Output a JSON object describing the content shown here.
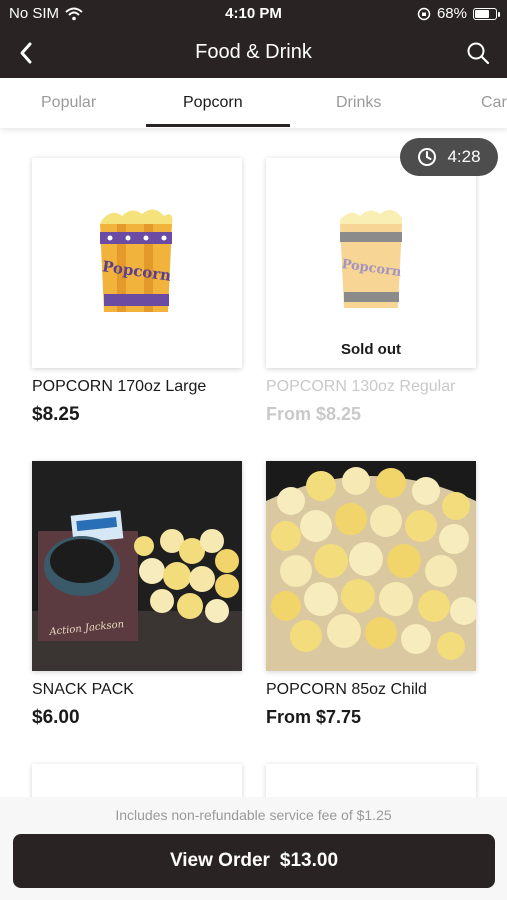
{
  "status": {
    "carrier": "No SIM",
    "time": "4:10 PM",
    "battery": "68%",
    "battery_level": 0.68
  },
  "header": {
    "title": "Food & Drink",
    "back_icon": "chevron-left-icon",
    "search_icon": "search-icon"
  },
  "tabs": [
    {
      "label": "Popular",
      "active": false
    },
    {
      "label": "Popcorn",
      "active": true
    },
    {
      "label": "Drinks",
      "active": false
    },
    {
      "label": "Car",
      "active": false
    }
  ],
  "timer": {
    "value": "4:28",
    "icon": "clock-icon"
  },
  "products": [
    {
      "name": "POPCORN 170oz Large",
      "price": "$8.25",
      "sold_out": false
    },
    {
      "name": "POPCORN 130oz Regular",
      "price": "From $8.25",
      "sold_out": true,
      "badge": "Sold out"
    },
    {
      "name": "SNACK PACK",
      "price": "$6.00",
      "sold_out": false
    },
    {
      "name": "POPCORN 85oz Child",
      "price": "From $7.75",
      "sold_out": false
    }
  ],
  "footer": {
    "fee_note": "Includes non-refundable service fee of $1.25",
    "order_label": "View Order",
    "order_total": "$13.00"
  },
  "colors": {
    "dark": "#2a2323",
    "muted": "#9a9a9a",
    "timer_bg": "#4d4d4d"
  }
}
